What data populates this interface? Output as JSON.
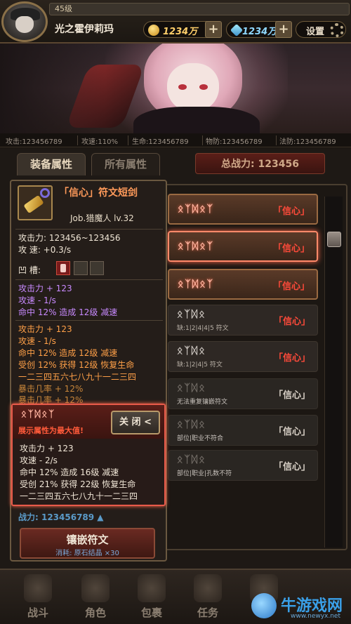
{
  "player": {
    "level": "45级",
    "name": "光之霍伊莉玛",
    "gold": "1234万",
    "gems": "1234万",
    "settings_label": "设置",
    "plus": "+"
  },
  "stats": [
    "攻击:123456789",
    "攻速:110%",
    "生命:123456789",
    "物防:123456789",
    "法防:123456789"
  ],
  "tabs": {
    "equip": "装备属性",
    "all": "所有属性",
    "total_power": "总战力: 123456"
  },
  "item": {
    "name": "「信心」符文短剑",
    "job": "Job.猎魔人 lv.32",
    "attack": "攻击力: 123456~123456",
    "speed": "攻    速: +0.3/s",
    "slots_label": "凹    槽:",
    "purple_lines": [
      "攻击力 + 123",
      "攻速 - 1/s",
      "命中 12% 造成 12级 减速"
    ],
    "orange_lines": [
      "攻击力 + 123",
      "攻速 - 1/s",
      "命中 12% 造成 12级 减速",
      "受创 12% 获得 12级 恢复生命",
      "一二三四五六七八九十一二三四"
    ],
    "orange_dim_lines": [
      "暴击几率 + 12%",
      "暴击几率 + 12%"
    ],
    "fight_power": "战力: 123456789 ▲"
  },
  "popup": {
    "runes": "ᛟᛉᛞᛟᛉ",
    "max_text": "展示属性为最大值!",
    "close_label": "关 闭 <",
    "lines": [
      "攻击力 + 123",
      "攻速 - 2/s",
      "命中 12% 造成 16级 减速",
      "受创 21% 获得 22级 恢复生命",
      "一二三四五六七八九十一二三四"
    ]
  },
  "inlay": {
    "label": "镶嵌符文",
    "cost": "消耗: 原石结晶 ×30"
  },
  "rune_list": [
    {
      "runes": "ᛟᛉᛞᛟᛉ",
      "name": "「信心」",
      "sub": ""
    },
    {
      "runes": "ᛟᛉᛞᛟᛉ",
      "name": "「信心」",
      "sub": ""
    },
    {
      "runes": "ᛟᛉᛞᛟᛉ",
      "name": "「信心」",
      "sub": ""
    },
    {
      "runes": "ᛟᛉᛞᛟ",
      "name": "「信心」",
      "sub": "缺:1|2|4|4|5 符文"
    },
    {
      "runes": "ᛟᛉᛞᛟ",
      "name": "「信心」",
      "sub": "缺:1|2|4|5 符文"
    },
    {
      "runes": "ᛟᛉᛞᛟ",
      "name": "「信心」",
      "sub": "无法重复镶嵌符文"
    },
    {
      "runes": "ᛟᛉᛞᛟ",
      "name": "「信心」",
      "sub": "部位|职业不符合"
    },
    {
      "runes": "ᛟᛉᛞᛟ",
      "name": "「信心」",
      "sub": "部位|职业|孔数不符"
    }
  ],
  "nav": [
    "战斗",
    "角色",
    "包裹",
    "任务",
    "城"
  ],
  "watermark": {
    "text": "牛游戏网",
    "url": "www.newyx.net"
  }
}
